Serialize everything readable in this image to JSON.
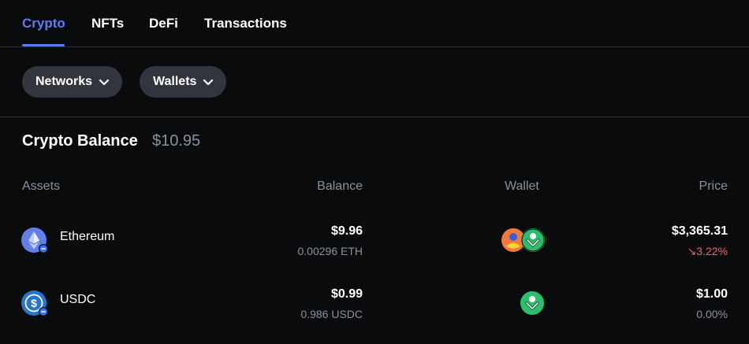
{
  "tabs": [
    {
      "label": "Crypto",
      "active": true
    },
    {
      "label": "NFTs",
      "active": false
    },
    {
      "label": "DeFi",
      "active": false
    },
    {
      "label": "Transactions",
      "active": false
    }
  ],
  "filters": {
    "networks_label": "Networks",
    "wallets_label": "Wallets"
  },
  "balance": {
    "title": "Crypto Balance",
    "value": "$10.95"
  },
  "table": {
    "headers": {
      "assets": "Assets",
      "balance": "Balance",
      "wallet": "Wallet",
      "price": "Price"
    },
    "rows": [
      {
        "name": "Ethereum",
        "icon": "ethereum-icon",
        "balance_fiat": "$9.96",
        "balance_token": "0.00296 ETH",
        "price": "$3,365.31",
        "change": "↘3.22%",
        "change_color": "#f0616d"
      },
      {
        "name": "USDC",
        "icon": "usdc-icon",
        "balance_fiat": "$0.99",
        "balance_token": "0.986 USDC",
        "price": "$1.00",
        "change": "0.00%",
        "change_color": "#8a919e"
      }
    ]
  },
  "colors": {
    "accent": "#5b7bff",
    "background": "#0a0b0d",
    "muted": "#8a919e",
    "negative": "#f0616d"
  }
}
